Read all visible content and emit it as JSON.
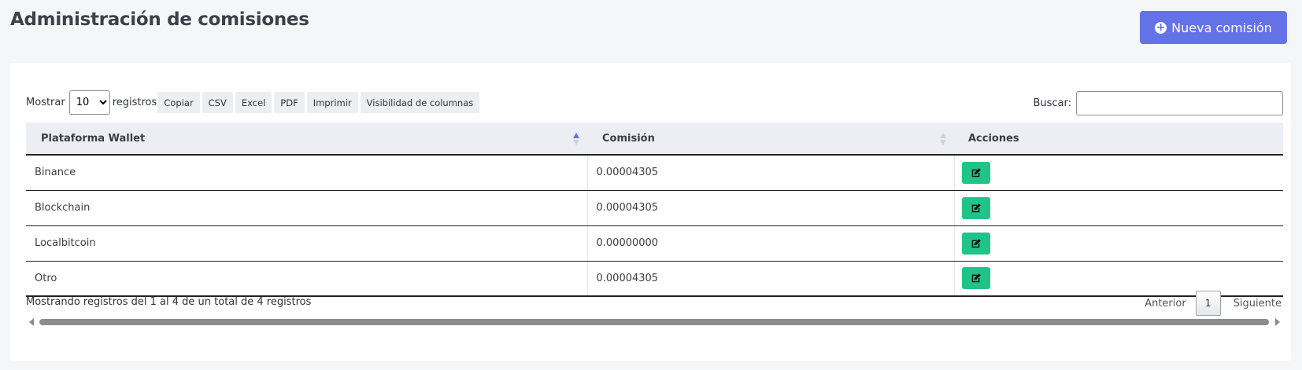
{
  "page": {
    "title": "Administración de comisiones"
  },
  "header": {
    "new_button_label": "Nueva comisión"
  },
  "toolbar": {
    "show_label": "Mostrar",
    "length_value": "10",
    "records_label": "registros",
    "buttons": [
      "Copiar",
      "CSV",
      "Excel",
      "PDF",
      "Imprimir",
      "Visibilidad de columnas"
    ]
  },
  "search": {
    "label": "Buscar:",
    "value": ""
  },
  "table": {
    "columns": [
      "Plataforma Wallet",
      "Comisión",
      "Acciones"
    ],
    "rows": [
      {
        "platform": "Binance",
        "commission": "0.00004305"
      },
      {
        "platform": "Blockchain",
        "commission": "0.00004305"
      },
      {
        "platform": "Localbitcoin",
        "commission": "0.00000000"
      },
      {
        "platform": "Otro",
        "commission": "0.00004305"
      }
    ]
  },
  "footer": {
    "info": "Mostrando registros del 1 al 4 de un total de 4 registros",
    "prev_label": "Anterior",
    "current_page": "1",
    "next_label": "Siguiente"
  },
  "colors": {
    "accent": "#6472e8",
    "edit": "#21c488"
  },
  "icons": {
    "new": "plus-circle-icon",
    "edit": "edit-square-icon"
  }
}
